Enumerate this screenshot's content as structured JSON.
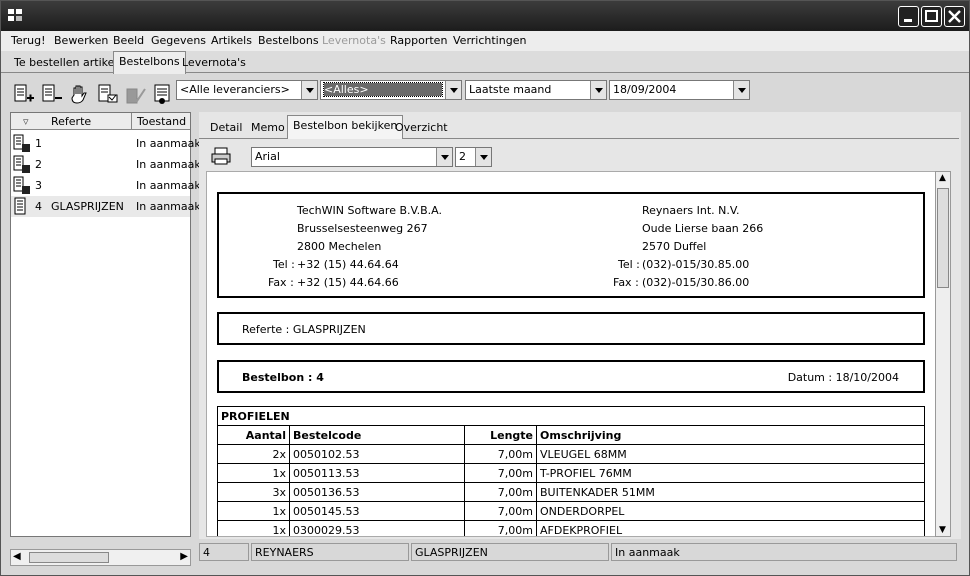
{
  "menu": [
    "Terug!",
    "Bewerken",
    "Beeld",
    "Gegevens",
    "Artikels",
    "Bestelbons",
    "Levernota's",
    "Rapporten",
    "Verrichtingen"
  ],
  "tabs_top": [
    "Te bestellen artikels",
    "Bestelbons",
    "Levernota's"
  ],
  "toolbar_icons": [
    "add-order-icon",
    "remove-order-icon",
    "hand-icon",
    "check-in-icon",
    "approve-icon",
    "print-order-icon"
  ],
  "filters": {
    "supplier": "<Alle leveranciers>",
    "status": "<Alles>",
    "period": "Laatste maand",
    "date": "18/09/2004"
  },
  "list": {
    "headers": [
      "Referte",
      "Toestand"
    ],
    "rows": [
      {
        "num": "1",
        "ref": "",
        "state": "In aanmaak"
      },
      {
        "num": "2",
        "ref": "",
        "state": "In aanmaak"
      },
      {
        "num": "3",
        "ref": "",
        "state": "In aanmaak"
      },
      {
        "num": "4",
        "ref": "GLASPRIJZEN",
        "state": "In aanmaak"
      }
    ]
  },
  "detail_tabs": [
    "Detail",
    "Memo",
    "Bestelbon bekijken",
    "Overzicht"
  ],
  "font_select": "Arial",
  "size_select": "2",
  "document": {
    "sender": [
      "TechWIN Software B.V.B.A.",
      "Brusselsesteenweg 267",
      "2800 Mechelen"
    ],
    "sender_tel_label": "Tel :",
    "sender_tel": "+32 (15) 44.64.64",
    "sender_fax_label": "Fax :",
    "sender_fax": "+32 (15) 44.64.66",
    "recipient": [
      "Reynaers Int. N.V.",
      "Oude Lierse baan 266",
      "2570 Duffel"
    ],
    "recipient_tel_label": "Tel :",
    "recipient_tel": "(032)-015/30.85.00",
    "recipient_fax_label": "Fax :",
    "recipient_fax": "(032)-015/30.86.00",
    "referte": "Referte : GLASPRIJZEN",
    "bestelbon": "Bestelbon : 4",
    "datum": "Datum : 18/10/2004",
    "section": "PROFIELEN",
    "columns": [
      "Aantal",
      "Bestelcode",
      "Lengte",
      "Omschrijving"
    ],
    "items": [
      [
        "2x",
        "0050102.53",
        "7,00m",
        "VLEUGEL 68MM"
      ],
      [
        "1x",
        "0050113.53",
        "7,00m",
        "T-PROFIEL 76MM"
      ],
      [
        "3x",
        "0050136.53",
        "7,00m",
        "BUITENKADER 51MM"
      ],
      [
        "1x",
        "0050145.53",
        "7,00m",
        "ONDERDORPEL"
      ],
      [
        "1x",
        "0300029.53",
        "7,00m",
        "AFDEKPROFIEL"
      ]
    ]
  },
  "status": [
    "4",
    "REYNAERS",
    "GLASPRIJZEN",
    "In aanmaak"
  ]
}
